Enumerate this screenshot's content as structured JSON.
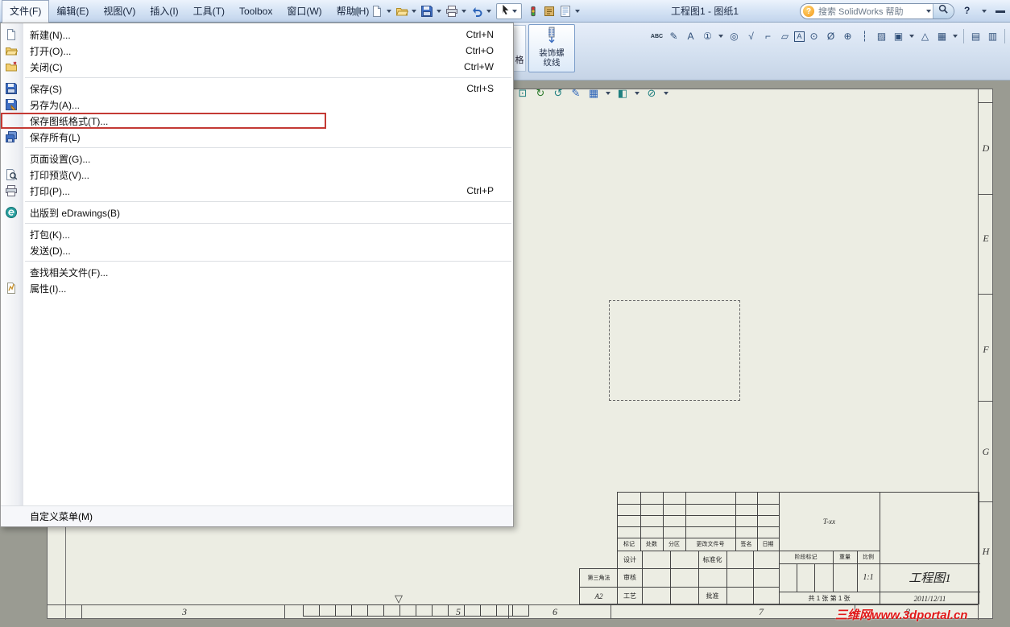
{
  "window": {
    "title": "工程图1 - 图纸1",
    "help_label": "?",
    "search_placeholder": "搜索 SolidWorks 帮助",
    "search_help_label": "?"
  },
  "menubar": {
    "items": [
      "文件(F)",
      "编辑(E)",
      "视图(V)",
      "插入(I)",
      "工具(T)",
      "Toolbox",
      "窗口(W)",
      "帮助(H)"
    ]
  },
  "quick_access_icons": [
    "new-document",
    "open",
    "save",
    "print",
    "undo",
    "select-arrow",
    "rebuild-traffic-light",
    "options",
    "sheet-properties"
  ],
  "file_menu": {
    "items": [
      {
        "label": "新建(N)...",
        "shortcut": "Ctrl+N"
      },
      {
        "label": "打开(O)...",
        "shortcut": "Ctrl+O"
      },
      {
        "label": "关闭(C)",
        "shortcut": "Ctrl+W"
      },
      {
        "label": "保存(S)",
        "shortcut": "Ctrl+S"
      },
      {
        "label": "另存为(A)..."
      },
      {
        "label": "保存图纸格式(T)..."
      },
      {
        "label": "保存所有(L)"
      },
      {
        "label": "页面设置(G)..."
      },
      {
        "label": "打印预览(V)..."
      },
      {
        "label": "打印(P)...",
        "shortcut": "Ctrl+P"
      },
      {
        "label": "出版到 eDrawings(B)"
      },
      {
        "label": "打包(K)..."
      },
      {
        "label": "发送(D)..."
      },
      {
        "label": "查找相关文件(F)..."
      },
      {
        "label": "属性(I)..."
      }
    ],
    "footer": "自定义菜单(M)"
  },
  "ribbon": {
    "thread_button_label": "装饰螺纹线",
    "partial_button_label": "格",
    "annotation_icons": [
      {
        "name": "spell-check",
        "glyph": "ABC"
      },
      {
        "name": "format-painter",
        "glyph": "✎"
      },
      {
        "name": "note",
        "glyph": "A"
      },
      {
        "name": "balloon",
        "glyph": "①"
      },
      {
        "name": "auto-balloon",
        "glyph": "◎"
      },
      {
        "name": "surface-finish",
        "glyph": "√"
      },
      {
        "name": "weld-symbol",
        "glyph": "⌐"
      },
      {
        "name": "geometric-tolerance",
        "glyph": "▱"
      },
      {
        "name": "datum-feature",
        "glyph": "A"
      },
      {
        "name": "datum-target",
        "glyph": "⊙"
      },
      {
        "name": "hole-callout",
        "glyph": "Ø"
      },
      {
        "name": "center-mark",
        "glyph": "⊕"
      },
      {
        "name": "centerline",
        "glyph": "┆"
      },
      {
        "name": "area-hatch",
        "glyph": "▨"
      },
      {
        "name": "block",
        "glyph": "▣"
      },
      {
        "name": "revision-symbol",
        "glyph": "△"
      },
      {
        "name": "table",
        "glyph": "▦"
      },
      {
        "name": "sheet-1",
        "glyph": "▤"
      },
      {
        "name": "sheet-2",
        "glyph": "▥"
      },
      {
        "name": "verify",
        "glyph": "✓"
      },
      {
        "name": "no-symbol",
        "glyph": "⊘"
      }
    ]
  },
  "view_toolbar": {
    "icons": [
      {
        "name": "zoom-fit",
        "glyph": "⊡"
      },
      {
        "name": "rotate-view",
        "glyph": "↻"
      },
      {
        "name": "redraw",
        "glyph": "↺"
      },
      {
        "name": "edit-annotation",
        "glyph": "✎"
      },
      {
        "name": "sheet-format",
        "glyph": "▦"
      },
      {
        "name": "display-style",
        "glyph": "◧"
      },
      {
        "name": "hide-show-items",
        "glyph": "⊘"
      }
    ]
  },
  "sheet": {
    "zones": {
      "letters": [
        "D",
        "E",
        "F",
        "G",
        "H"
      ],
      "numbers": [
        "3",
        "5",
        "6",
        "7",
        "8"
      ]
    },
    "center_mark": "▽",
    "watermark": "三维网www.3dportal.cn",
    "title_block": {
      "rev_cols": [
        "标记",
        "处数",
        "分区",
        "更改文件号",
        "签名",
        "日期"
      ],
      "design": "设计",
      "standard": "标准化",
      "audit": "审核",
      "process": "工艺",
      "approve": "批准",
      "stage": "阶段标记",
      "weight": "重量",
      "scale": "比例",
      "scale_val": "1:1",
      "total": "共 1 张 第 1 张",
      "title": "工程图1",
      "date": "2011/12/11",
      "code": "T-xx",
      "projection": "第三角法",
      "size": "A2"
    }
  }
}
